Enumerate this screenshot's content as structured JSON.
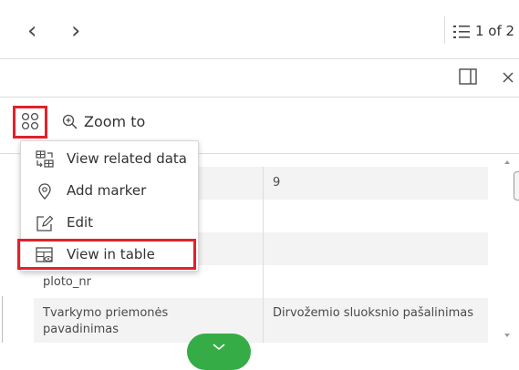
{
  "header": {
    "prev_symbol": "‹",
    "next_symbol": "›",
    "counter": "1 of 2"
  },
  "toolbar": {
    "zoom_label": "Zoom to"
  },
  "menu": {
    "items": [
      {
        "label": "View related data",
        "icon": "related-data-icon"
      },
      {
        "label": "Add marker",
        "icon": "marker-icon"
      },
      {
        "label": "Edit",
        "icon": "edit-icon"
      },
      {
        "label": "View in table",
        "icon": "table-view-icon"
      }
    ]
  },
  "table": {
    "rows": [
      {
        "field": "",
        "value": "9"
      },
      {
        "field": "",
        "value": ""
      },
      {
        "field": "",
        "value": ""
      },
      {
        "field": "ploto_nr",
        "value": ""
      },
      {
        "field": "Tvarkymo priemonės pavadinimas",
        "value": "Dirvožemio sluoksnio pašalinimas"
      }
    ],
    "row5_field_line1": "Tvarkymo priemonės",
    "row5_field_line2": "pavadinimas"
  },
  "colors": {
    "highlight": "#e4202b",
    "row_shade": "#f3f3f3",
    "divider": "#dcdcdc",
    "fab": "#35ac46"
  }
}
